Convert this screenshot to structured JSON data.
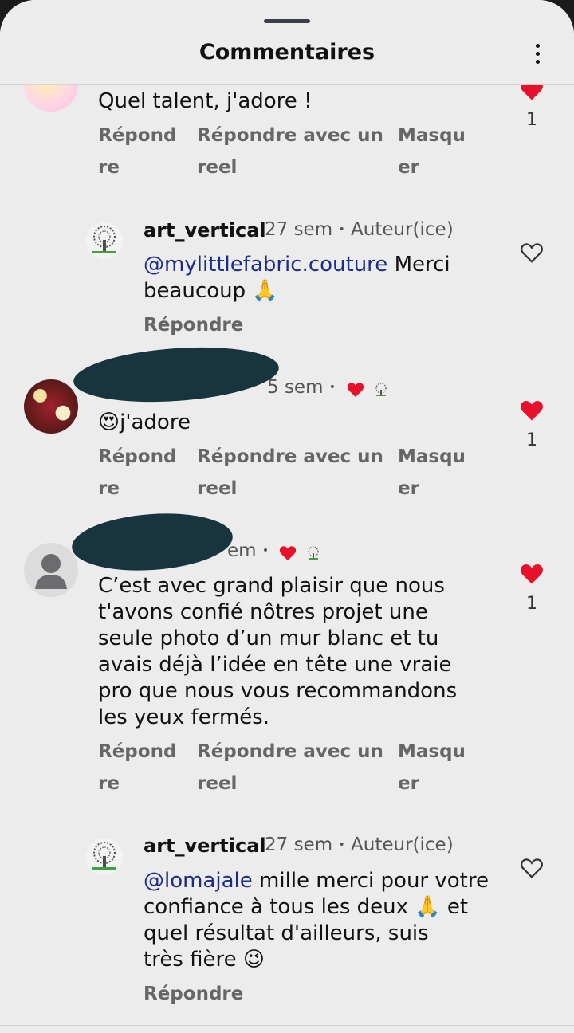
{
  "header": {
    "title": "Commentaires",
    "menu_icon": "more-vertical-icon"
  },
  "comments": [
    {
      "text": "Quel talent, j'adore !",
      "likes": "1",
      "liked": true,
      "actions": {
        "reply_l1": "Répond",
        "reply_l2": "re",
        "reel_l1": "Répondre avec un",
        "reel_l2": "reel",
        "hide_l1": "Masqu",
        "hide_l2": "er"
      }
    },
    {
      "author": "art_vertical",
      "time": "27 sem",
      "role": "Auteur(ice)",
      "mention": "@mylittlefabric.couture",
      "text_after_mention": " Merci",
      "text_line2": "beaucoup 🙏",
      "reply": "Répondre"
    },
    {
      "time": "5 sem",
      "text": "😍j'adore",
      "likes": "1",
      "liked": true,
      "actions": {
        "reply_l1": "Répond",
        "reply_l2": "re",
        "reel_l1": "Répondre avec un",
        "reel_l2": "reel",
        "hide_l1": "Masqu",
        "hide_l2": "er"
      }
    },
    {
      "time": "em",
      "lines": [
        "C’est avec grand plaisir que nous",
        "t'avons confié nôtres projet une",
        "seule photo d’un mur blanc et tu",
        "avais déjà l’idée en tête une vraie",
        "pro que nous vous recommandons",
        "les yeux fermés."
      ],
      "likes": "1",
      "liked": true,
      "actions": {
        "reply_l1": "Répond",
        "reply_l2": "re",
        "reel_l1": "Répondre avec un",
        "reel_l2": "reel",
        "hide_l1": "Masqu",
        "hide_l2": "er"
      }
    },
    {
      "author": "art_vertical",
      "time": "27 sem",
      "role": "Auteur(ice)",
      "mention": "@lomajale",
      "text_after_mention": " mille merci pour votre",
      "lines": [
        "confiance à tous les deux 🙏 et",
        "quel résultat d'ailleurs,  suis",
        "très fière 😉"
      ],
      "reply": "Répondre"
    }
  ],
  "separator": "•",
  "colors": {
    "heart": "#e8102a",
    "mention": "#1b2c8a",
    "action": "#666666",
    "background": "#ececec"
  }
}
